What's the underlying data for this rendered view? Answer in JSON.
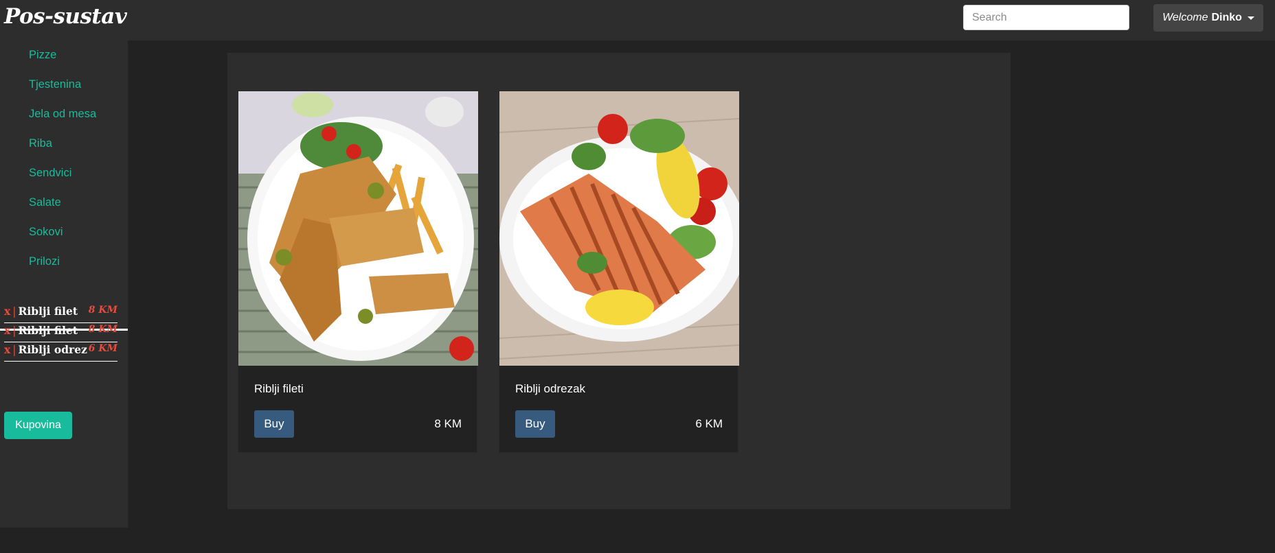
{
  "header": {
    "brand": "Pos-sustav",
    "search_placeholder": "Search",
    "welcome_label": "Welcome",
    "user_name": "Dinko"
  },
  "sidebar": {
    "categories": [
      "Pizze",
      "Tjestenina",
      "Jela od mesa",
      "Riba",
      "Sendvici",
      "Salate",
      "Sokovi",
      "Prilozi"
    ]
  },
  "cart": {
    "items": [
      {
        "remove": "x",
        "sep": "|",
        "name": "Riblji filet",
        "price": "8 KM"
      },
      {
        "remove": "x",
        "sep": "|",
        "name": "Riblji filet",
        "price": "8 KM"
      },
      {
        "remove": "x",
        "sep": "|",
        "name": "Riblji odrez",
        "price": "6 KM"
      }
    ],
    "checkout_label": "Kupovina"
  },
  "products": [
    {
      "name": "Riblji fileti",
      "buy_label": "Buy",
      "price": "8 KM"
    },
    {
      "name": "Riblji odrezak",
      "buy_label": "Buy",
      "price": "6 KM"
    }
  ],
  "colors": {
    "accent": "#18bc9c",
    "danger": "#e74c3c",
    "primary": "#375a7f",
    "panel": "#2d2d2d",
    "background": "#222222"
  }
}
